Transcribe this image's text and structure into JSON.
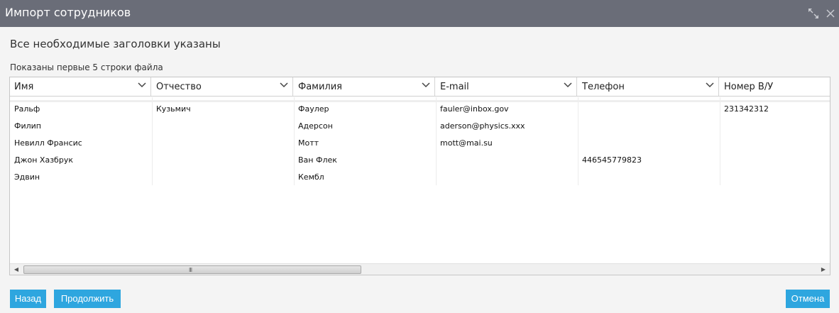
{
  "window": {
    "title": "Импорт сотрудников",
    "maximize_icon": "expand-icon",
    "close_icon": "close-icon"
  },
  "heading": "Все необходимые заголовки указаны",
  "subheading": "Показаны первые 5 строки файла",
  "columns": [
    "Имя",
    "Отчество",
    "Фамилия",
    "E-mail",
    "Телефон",
    "Номер В/У"
  ],
  "rows": [
    [
      "Ральф",
      "Кузьмич",
      "Фаулер",
      "fauler@inbox.gov",
      "",
      "231342312"
    ],
    [
      "Филип",
      "",
      "Адерсон",
      "aderson@physics.xxx",
      "",
      ""
    ],
    [
      "Невилл Франсис",
      "",
      "Мотт",
      "mott@mai.su",
      "",
      ""
    ],
    [
      "Джон Хазбрук",
      "",
      "Ван Флек",
      "",
      "446545779823",
      ""
    ],
    [
      "Эдвин",
      "",
      "Кембл",
      "",
      "",
      ""
    ]
  ],
  "scrollbar": {
    "left_arrow": "◀",
    "right_arrow": "▶",
    "grip": "III"
  },
  "buttons": {
    "back": "Назад",
    "continue": "Продолжить",
    "cancel": "Отмена"
  },
  "colors": {
    "titlebar": "#6a6d78",
    "accent": "#2ea6df",
    "background": "#f4f4f4"
  }
}
